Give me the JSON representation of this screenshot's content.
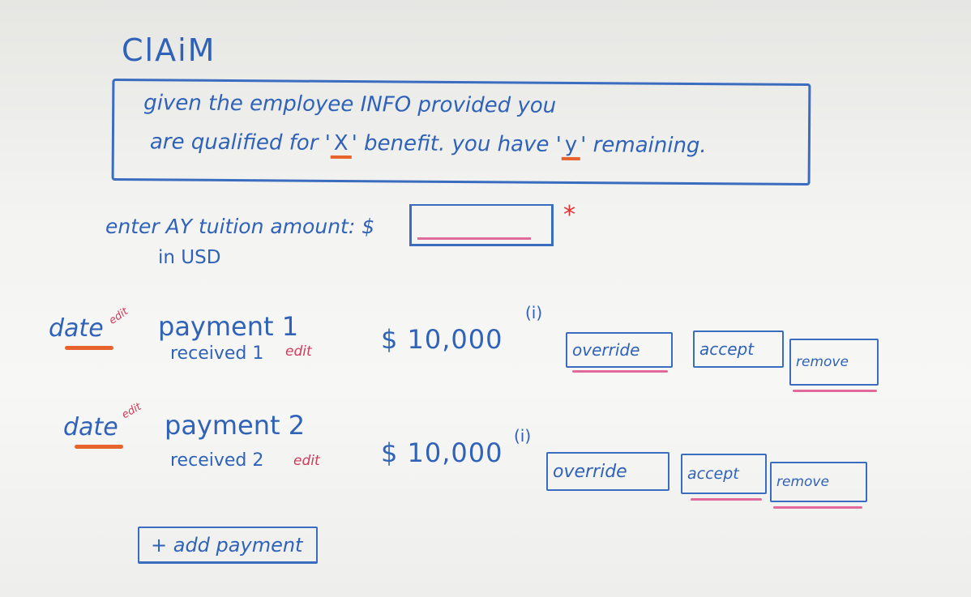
{
  "title": "ClAiM",
  "banner": {
    "line1": "given the employee INFO provided you",
    "line2_pre": "are qualified for '",
    "line2_x": "X",
    "line2_mid": "' benefit. you have '",
    "line2_y": "y",
    "line2_post": "' remaining."
  },
  "tuition": {
    "label": "enter AY tuition amount: $",
    "sublabel": "in USD",
    "value": "",
    "placeholder": "",
    "required_mark": "*"
  },
  "payments": [
    {
      "date_label": "date",
      "date_edit": "edit",
      "name": "payment 1",
      "received": "received 1",
      "received_edit": "edit",
      "amount": "$ 10,000",
      "info": "(i)",
      "override_label": "override",
      "accept_label": "accept",
      "remove_label": "remove"
    },
    {
      "date_label": "date",
      "date_edit": "edit",
      "name": "payment 2",
      "received": "received 2",
      "received_edit": "edit",
      "amount": "$ 10,000",
      "info": "(i)",
      "override_label": "override",
      "accept_label": "accept",
      "remove_label": "remove"
    }
  ],
  "add_payment_label": "+ add payment",
  "colors": {
    "ink_blue": "#2f62b8",
    "accent_orange": "#e8622c",
    "accent_pink": "#e06a9a",
    "accent_red": "#e23232"
  }
}
